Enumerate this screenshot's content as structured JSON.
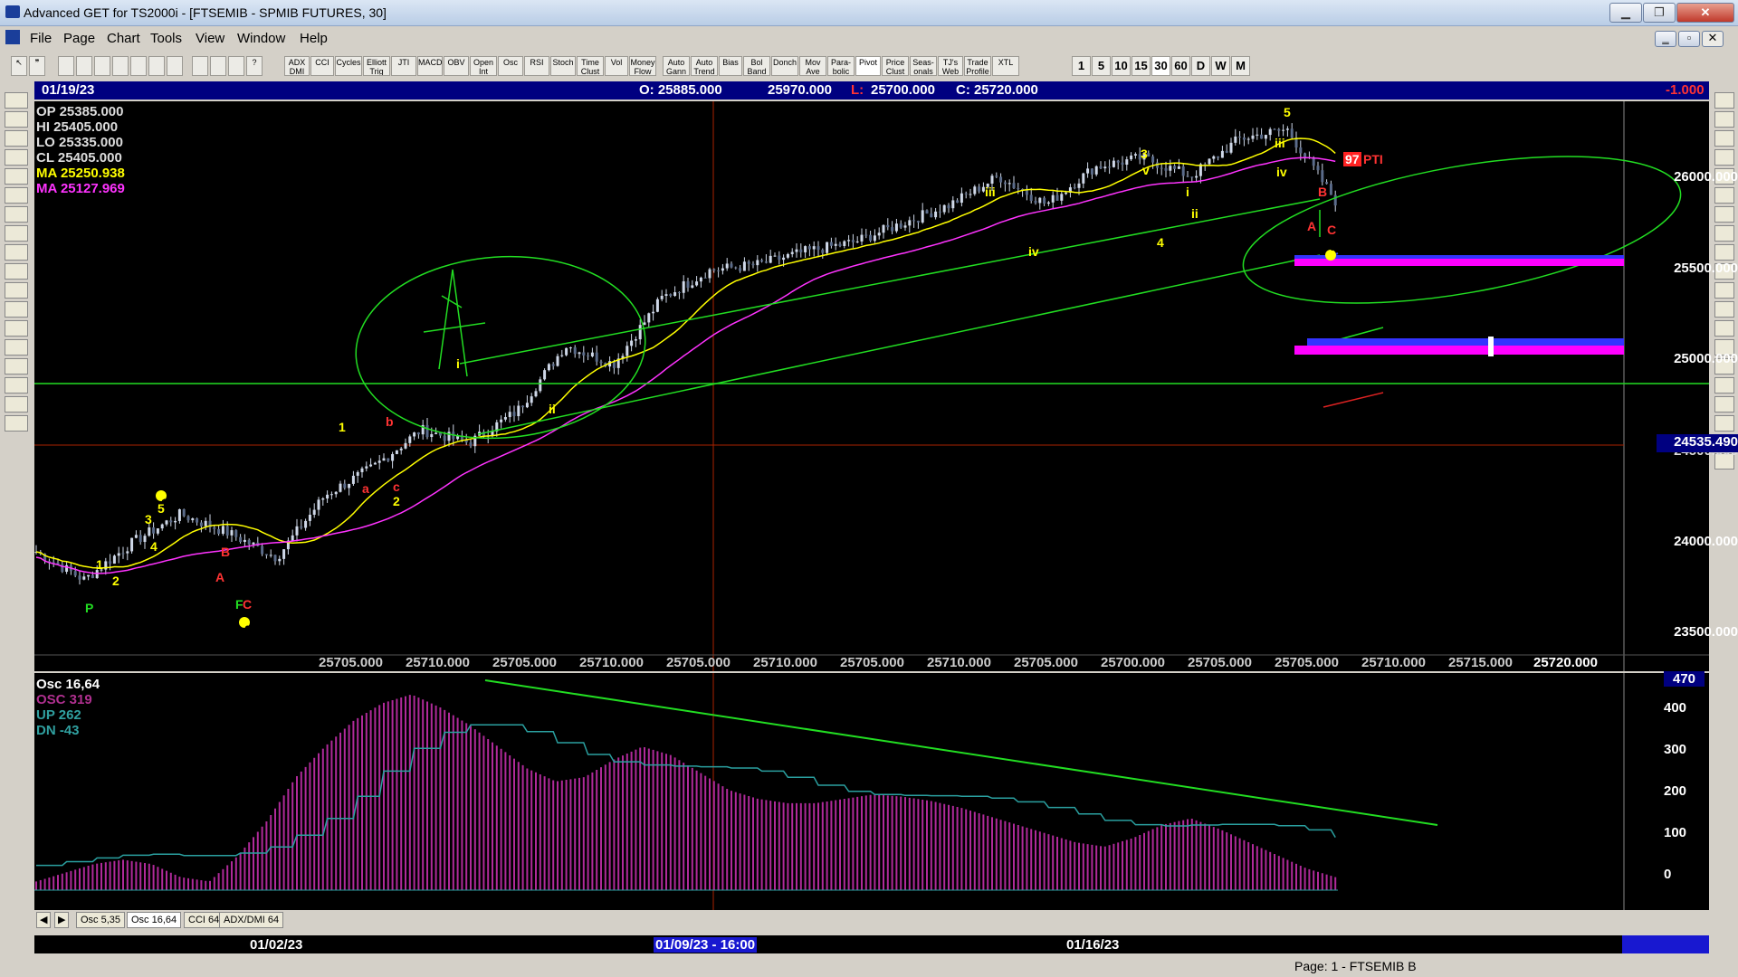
{
  "window": {
    "title": "Advanced GET for TS2000i - [FTSEMIB - SPMIB FUTURES, 30]",
    "min": "▁",
    "restore": "❐",
    "close": "✕",
    "min2": "‗",
    "restore2": "▫",
    "close2": "✕"
  },
  "menu": [
    "File",
    "Page",
    "Chart",
    "Tools",
    "View",
    "Window",
    "Help"
  ],
  "toolbar_buttons": [
    "ADX DMI",
    "CCI",
    "Cycles",
    "Elliott Trig",
    "JTI",
    "MACD",
    "OBV",
    "Open Int",
    "Osc",
    "RSI",
    "Stoch",
    "Time Clust",
    "Vol",
    "Money Flow",
    "Auto Gann",
    "Auto Trend",
    "Bias",
    "Bol Band",
    "Donch",
    "Mov Ave",
    "Para-bolic",
    "Pivot",
    "Price Clust",
    "Seas-onals",
    "TJ's Web",
    "Trade Profile",
    "XTL"
  ],
  "interval_buttons": [
    "1",
    "5",
    "10",
    "15",
    "30",
    "60",
    "D",
    "W",
    "M"
  ],
  "header": {
    "date": "01/19/23",
    "open": "O: 25885.000",
    "high": "25970.000",
    "low_prefix": "L:",
    "low": "25700.000",
    "close": "C: 25720.000",
    "change": "-1.000"
  },
  "bar_info": [
    {
      "label": "OP",
      "value": "25385.000",
      "color": "#e0e0e0"
    },
    {
      "label": "HI",
      "value": "25405.000",
      "color": "#e0e0e0"
    },
    {
      "label": "LO",
      "value": "25335.000",
      "color": "#e0e0e0"
    },
    {
      "label": "CL",
      "value": "25405.000",
      "color": "#e0e0e0"
    },
    {
      "label": "MA",
      "value": "25250.938",
      "color": "#ffff00"
    },
    {
      "label": "MA",
      "value": "25127.969",
      "color": "#ff33ff"
    }
  ],
  "price_axis": [
    "26000.000",
    "25500.000",
    "25000.000",
    "24000.000",
    "23500.000"
  ],
  "price_axis_partial": "24500.000",
  "cursor_price": "24535.490",
  "x_axis_labels": [
    "25705.000",
    "25710.000",
    "25705.000",
    "25710.000",
    "25705.000",
    "25710.000",
    "25705.000",
    "25710.000",
    "25705.000",
    "25700.000",
    "25705.000",
    "25705.000",
    "25710.000",
    "25715.000"
  ],
  "x_axis_last": "25720.000",
  "wave_labels": [
    "1",
    "2",
    "3",
    "4",
    "5",
    "1",
    "2",
    "P",
    "A",
    "B",
    "C",
    "F",
    "1",
    "a",
    "b",
    "c",
    "2",
    "i",
    "ii",
    "iii",
    "iv",
    "3",
    "v",
    "4",
    "i",
    "ii",
    "iii",
    "iv",
    "5",
    "A",
    "B",
    "C",
    "4",
    "97",
    "PTI"
  ],
  "osc_info": [
    {
      "label": "Osc 16,64",
      "color": "#ffffff"
    },
    {
      "label": "OSC 319",
      "color": "#b03090"
    },
    {
      "label": "UP   262",
      "color": "#30a0a0"
    },
    {
      "label": "DN   -43",
      "color": "#30a0a0"
    }
  ],
  "osc_axis": [
    "470",
    "400",
    "300",
    "200",
    "100",
    "0"
  ],
  "tabs": [
    "Osc 5,35",
    "Osc 16,64",
    "CCI 64",
    "ADX/DMI 64"
  ],
  "dates": [
    "01/02/23",
    "01/09/23 - 16:00",
    "01/16/23"
  ],
  "status": "Page: 1 - FTSEMIB B",
  "colors": {
    "background": "#000000",
    "moving_average_1": "#ffff00",
    "moving_average_2": "#ff33ff",
    "trendline": "#22dd22",
    "osc_histogram": "#b02a9a",
    "osc_signal": "#2aa0a0",
    "header_bar": "#000080"
  },
  "chart_data": {
    "type": "candlestick",
    "price_range": [
      23300,
      26250
    ],
    "close_trend": [
      23850,
      23700,
      23900,
      24050,
      23950,
      23820,
      24150,
      24300,
      24500,
      24430,
      24600,
      24950,
      24850,
      25200,
      25350,
      25380,
      25450,
      25500,
      25600,
      25700,
      25850,
      25700,
      25900,
      25950,
      25850,
      26050,
      26100,
      25720
    ],
    "oscillator": {
      "name": "OSC",
      "last": 319,
      "up": 262,
      "dn": -43,
      "range": [
        -50,
        470
      ]
    }
  }
}
